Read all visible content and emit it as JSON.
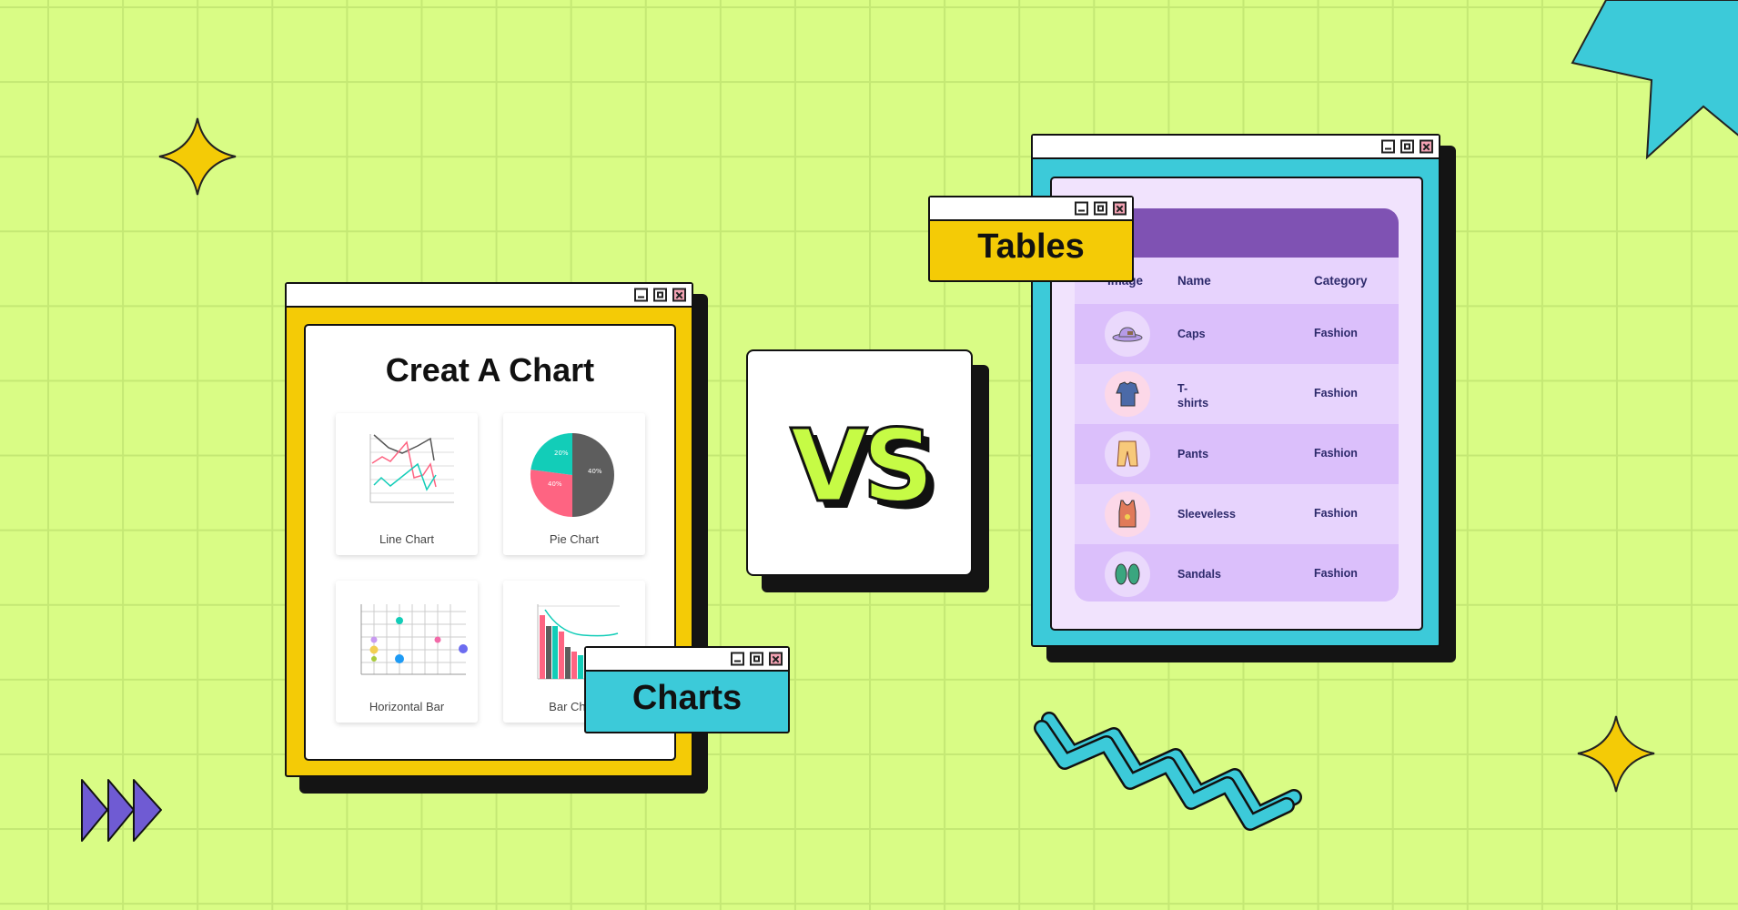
{
  "left_window": {
    "title": "Creat A Chart",
    "cards": [
      {
        "label": "Line Chart"
      },
      {
        "label": "Pie Chart",
        "slices": [
          {
            "label": "20%",
            "value": 20,
            "color": "#12cdb8"
          },
          {
            "label": "40%",
            "value": 40,
            "color": "#fe6482"
          },
          {
            "label": "40%",
            "value": 40,
            "color": "#5d5d5d"
          }
        ]
      },
      {
        "label": "Horizontal Bar"
      },
      {
        "label": "Bar Chart"
      }
    ]
  },
  "charts_window": {
    "label": "Charts"
  },
  "vs_card": {
    "label": "VS"
  },
  "tables_window": {
    "label": "Tables"
  },
  "table": {
    "columns": [
      "Image",
      "Name",
      "Category"
    ],
    "rows": [
      {
        "name": "Caps",
        "category": "Fashion",
        "icon": "cap-icon"
      },
      {
        "name": "T-\nshirts",
        "category": "Fashion",
        "icon": "tshirt-icon"
      },
      {
        "name": "Pants",
        "category": "Fashion",
        "icon": "pants-icon"
      },
      {
        "name": "Sleeveless",
        "category": "Fashion",
        "icon": "tank-top-icon"
      },
      {
        "name": "Sandals",
        "category": "Fashion",
        "icon": "sandals-icon"
      }
    ]
  },
  "colors": {
    "background": "#d9fc85",
    "yellow": "#f4cb06",
    "cyan": "#3ccad9",
    "purple": "#7f52b3",
    "lime": "#c6fb45"
  }
}
